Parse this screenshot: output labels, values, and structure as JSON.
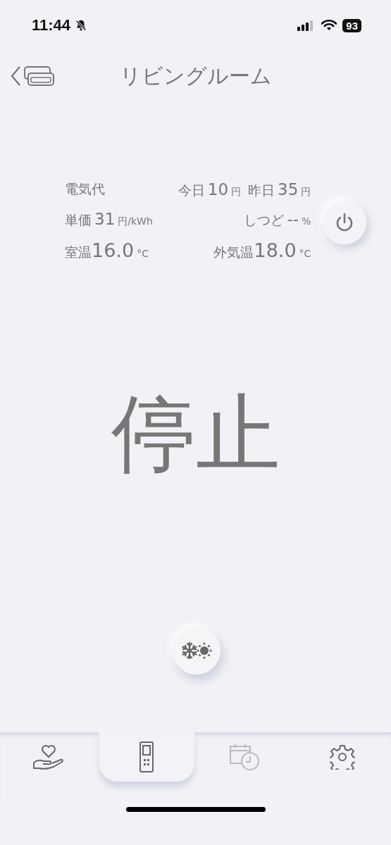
{
  "status_bar": {
    "time": "11:44",
    "battery": "93"
  },
  "header": {
    "title": "リビングルーム"
  },
  "info": [
    {
      "parts": [
        {
          "kind": "label",
          "text": "電気代"
        }
      ],
      "right": [
        {
          "kind": "label",
          "text": "今日"
        },
        {
          "kind": "value",
          "text": "10"
        },
        {
          "kind": "unit",
          "text": "円"
        },
        {
          "kind": "label",
          "text": "昨日"
        },
        {
          "kind": "value",
          "text": "35"
        },
        {
          "kind": "unit",
          "text": "円"
        }
      ]
    },
    {
      "parts": [
        {
          "kind": "label",
          "text": "単価"
        },
        {
          "kind": "value",
          "text": "31"
        },
        {
          "kind": "unit",
          "text": "円/kWh"
        }
      ],
      "right": [
        {
          "kind": "label",
          "text": "しつど"
        },
        {
          "kind": "value",
          "text": "--"
        },
        {
          "kind": "unit",
          "text": "%"
        }
      ]
    },
    {
      "parts": [
        {
          "kind": "label",
          "text": "室温"
        },
        {
          "kind": "big",
          "text": "16.0"
        },
        {
          "kind": "unit",
          "text": "°C"
        }
      ],
      "right": [
        {
          "kind": "label",
          "text": "外気温"
        },
        {
          "kind": "big",
          "text": "18.0"
        },
        {
          "kind": "unit",
          "text": "°C"
        }
      ]
    }
  ],
  "status_text": "停止",
  "tabs": [
    {
      "kind": "care",
      "selected": false,
      "disabled": false
    },
    {
      "kind": "remote",
      "selected": true,
      "disabled": false
    },
    {
      "kind": "schedule",
      "selected": false,
      "disabled": true
    },
    {
      "kind": "settings",
      "selected": false,
      "disabled": false
    }
  ]
}
